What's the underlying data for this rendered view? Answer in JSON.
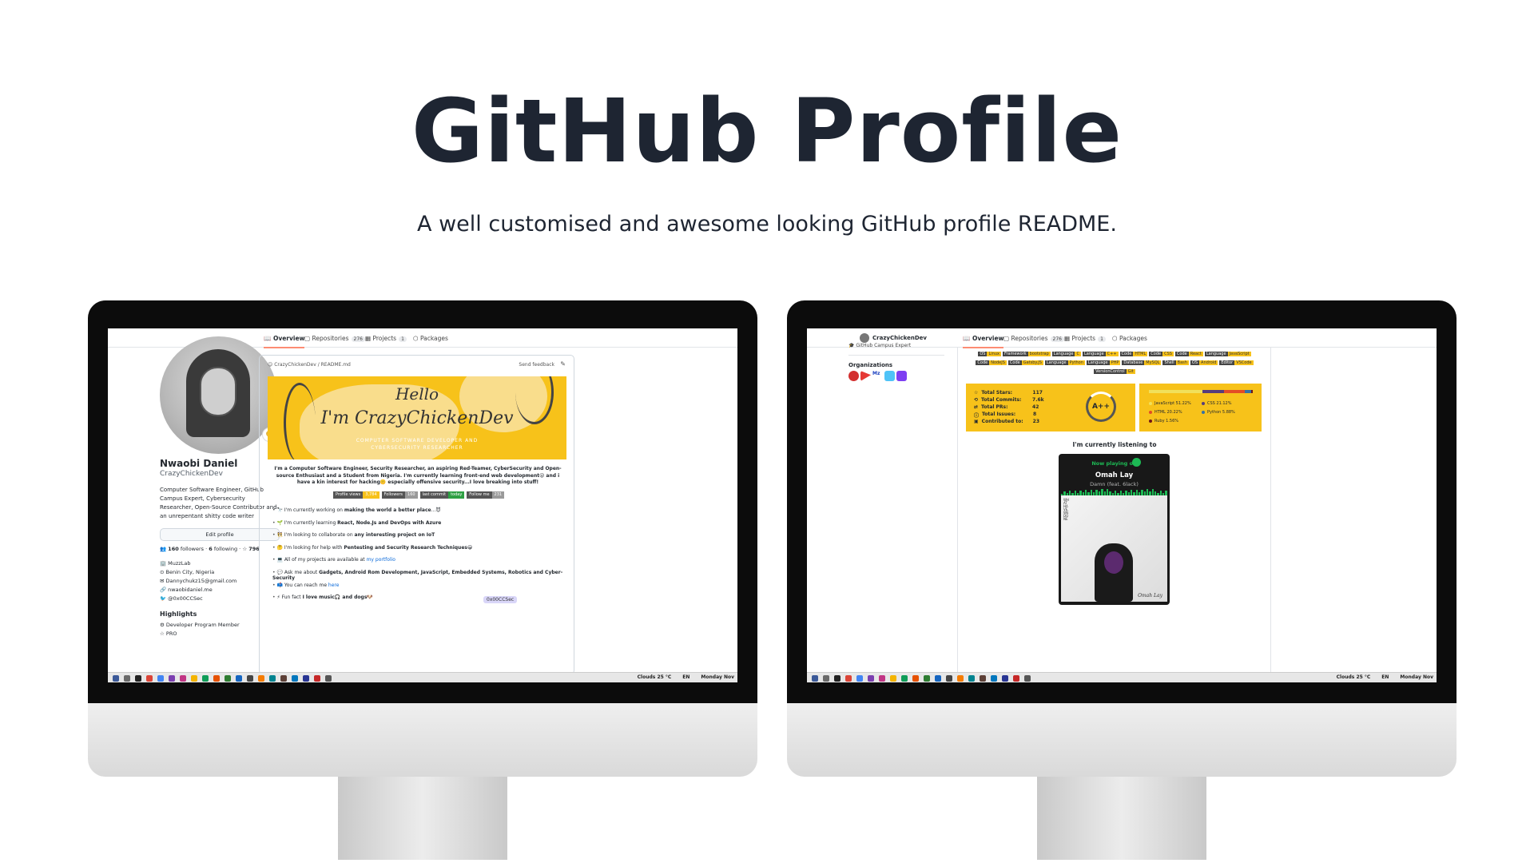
{
  "hero": {
    "title": "GitHub Profile",
    "subtitle": "A well customised and awesome looking GitHub profile README."
  },
  "left_screen": {
    "tabs": [
      {
        "label": "Overview",
        "count": ""
      },
      {
        "label": "Repositories",
        "count": "276"
      },
      {
        "label": "Projects",
        "count": "1"
      },
      {
        "label": "Packages",
        "count": ""
      }
    ],
    "profile": {
      "name": "Nwaobi Daniel",
      "username": "CrazyChickenDev",
      "bio": "Computer Software Engineer, GitHub Campus Expert, Cybersecurity Researcher, Open-Source Contributor and an unrepentant shitty code writer",
      "edit_label": "Edit profile",
      "followers": "160",
      "followers_label": "followers",
      "following": "6",
      "following_label": "following",
      "stars": "796",
      "company": "MuzzLab",
      "location": "Benin City, Nigeria",
      "email": "Dannychukz15@gmail.com",
      "website": "nwaobidaniel.me",
      "twitter": "@0x00CCSec",
      "highlights_title": "Highlights",
      "highlight_1": "Developer Program Member",
      "highlight_2": "PRO"
    },
    "readme": {
      "path": "CrazyChickenDev / README.md",
      "feedback": "Send feedback",
      "banner_hello": "Hello",
      "banner_name": "I'm CrazyChickenDev",
      "banner_sub": "COMPUTER SOFTWARE DEVELOPER AND CYBERSECURITY RESEARCHER",
      "intro": "I'm a Computer Software Engineer, Security Researcher, an aspiring Red-Teamer, CyberSecurity and Open-source Enthusiast and a Student from Nigeria. I'm currently learning front-end web development😜 and i have a kin interest for hacking🤫 especially offensive security...I love breaking into stuff!",
      "badges": [
        {
          "key": "Profile views",
          "value": "3,784",
          "color": "#f7c21a"
        },
        {
          "key": "Followers",
          "value": "160",
          "color": "#9a9a9a"
        },
        {
          "key": "last commit",
          "value": "today",
          "color": "#2ea043"
        },
        {
          "key": "Follow me",
          "value": "231",
          "color": "#9a9a9a"
        }
      ],
      "bullets": [
        {
          "pre": "🔭 I'm currently working on ",
          "bold": "making the world a better place",
          "post": "...😈"
        },
        {
          "pre": "🌱 I'm currently learning ",
          "bold": "React, Node.Js and DevOps with Azure",
          "post": ""
        },
        {
          "pre": "👯 I'm looking to collaborate on ",
          "bold": "any interesting project on IoT",
          "post": ""
        },
        {
          "pre": "🤔 I'm looking for help with ",
          "bold": "Pentesting and Security Research Techniques",
          "post": "😁"
        },
        {
          "pre": "💻 All of my projects are available at ",
          "link": "my portfolio",
          "post": ""
        },
        {
          "pre": "💬 Ask me about ",
          "bold": "Gadgets, Android Rom Development, JavaScript, Embedded Systems, Robotics and Cyber-Security",
          "post": ""
        },
        {
          "pre": "📫 You can reach me ",
          "link": "here",
          "post": ""
        },
        {
          "pre": "⚡ Fun fact ",
          "bold": "I love music🎧 and dogs",
          "post": "🐶"
        }
      ],
      "tooltip": "0x00CCSec"
    },
    "taskbar": {
      "weather": "Clouds 25 °C",
      "lang": "EN",
      "date": "Monday Nov"
    }
  },
  "right_screen": {
    "user": "CrazyChickenDev",
    "expert": "GitHub Campus Expert",
    "orgs_title": "Organizations",
    "tabs": [
      {
        "label": "Overview",
        "count": ""
      },
      {
        "label": "Repositories",
        "count": "276"
      },
      {
        "label": "Projects",
        "count": "1"
      },
      {
        "label": "Packages",
        "count": ""
      }
    ],
    "tech": [
      [
        "OS",
        "Linux"
      ],
      [
        "Framework",
        "bootstrap"
      ],
      [
        "Language",
        "C"
      ],
      [
        "Language",
        "C++"
      ],
      [
        "Code",
        "HTML"
      ],
      [
        "Code",
        "CSS"
      ],
      [
        "Code",
        "React"
      ],
      [
        "Language",
        "JavaScript"
      ],
      [
        "Code",
        "NodeJS"
      ],
      [
        "Code",
        "Gatsby.JS"
      ],
      [
        "Language",
        "Python"
      ],
      [
        "Language",
        "PHP"
      ],
      [
        "Database",
        "MySQL"
      ],
      [
        "Shell",
        "Bash"
      ],
      [
        "OS",
        "Android"
      ],
      [
        "Editor",
        "VSCode"
      ],
      [
        "VersionControl",
        "Git"
      ]
    ],
    "stats": [
      {
        "label": "Total Stars:",
        "value": "117"
      },
      {
        "label": "Total Commits:",
        "value": "7.6k"
      },
      {
        "label": "Total PRs:",
        "value": "42"
      },
      {
        "label": "Total Issues:",
        "value": "8"
      },
      {
        "label": "Contributed to:",
        "value": "23"
      }
    ],
    "grade": "A++",
    "languages": [
      {
        "name": "JavaScript 51.22%",
        "pct": 51.22,
        "color": "#f1e05a"
      },
      {
        "name": "CSS 21.12%",
        "pct": 21.12,
        "color": "#563d7c"
      },
      {
        "name": "HTML 20.22%",
        "pct": 20.22,
        "color": "#e34c26"
      },
      {
        "name": "Python 5.88%",
        "pct": 5.88,
        "color": "#3572a5"
      },
      {
        "name": "Ruby 1.56%",
        "pct": 1.56,
        "color": "#701516"
      }
    ],
    "listening_title": "I'm currently listening to",
    "spotify": {
      "now_playing": "Now playing on",
      "artist": "Omah Lay",
      "song": "Damn (feat. 6lack)",
      "art_text": "WHAT HAVE WE DONE",
      "signature": "Omah Lay"
    },
    "taskbar": {
      "weather": "Clouds 25 °C",
      "lang": "EN",
      "date": "Monday Nov"
    }
  }
}
